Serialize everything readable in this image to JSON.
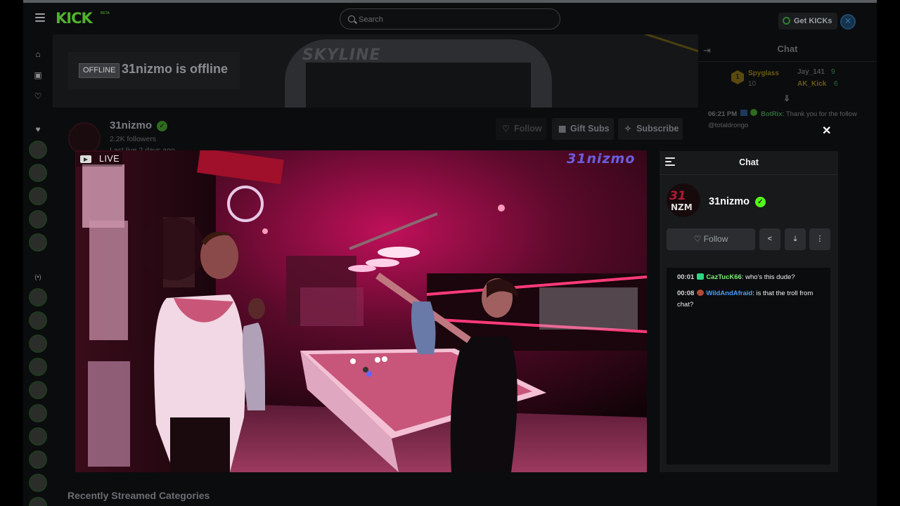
{
  "header": {
    "logo": "KICK",
    "logo_beta": "BETA",
    "search_placeholder": "Search",
    "get_kicks_label": "Get KICKs"
  },
  "banner": {
    "offline_badge": "OFFLINE",
    "offline_text": "31nizmo is offline",
    "banner_text": "SKYLINE"
  },
  "channel": {
    "name": "31nizmo",
    "followers": "2.2K followers",
    "last_live": "Last live 2 days ago",
    "follow_label": "Follow",
    "gift_subs_label": "Gift Subs",
    "subscribe_label": "Subscribe",
    "recent_categories_title": "Recently Streamed Categories"
  },
  "page_chat": {
    "title": "Chat",
    "leaderboard": [
      {
        "rank": "1",
        "name": "Spyglass",
        "count": "10"
      },
      {
        "name": "Jay_141",
        "count": "9"
      },
      {
        "name": "AK_Kick",
        "count": "6"
      }
    ],
    "message": {
      "time": "06:21 PM",
      "user": "BotRix",
      "text": ": Thank you for the follow @totaldrongo"
    }
  },
  "player": {
    "live_label": "LIVE",
    "watermark": "31nizmo"
  },
  "popout_chat": {
    "title": "Chat",
    "channel_name": "31nizmo",
    "avatar_line1": "31",
    "avatar_line2": "NZM",
    "follow_label": "Follow",
    "messages": [
      {
        "time": "00:01",
        "user": "CazTucK66",
        "user_color": "#7cf07c",
        "text": ": who's this dude?"
      },
      {
        "time": "00:08",
        "user": "WildAndAfraid",
        "user_color": "#4a9cff",
        "text": ": is that the troll from chat?"
      }
    ]
  },
  "colors": {
    "brand_green": "#53fc18",
    "live_neon": "#ff1f6e"
  }
}
